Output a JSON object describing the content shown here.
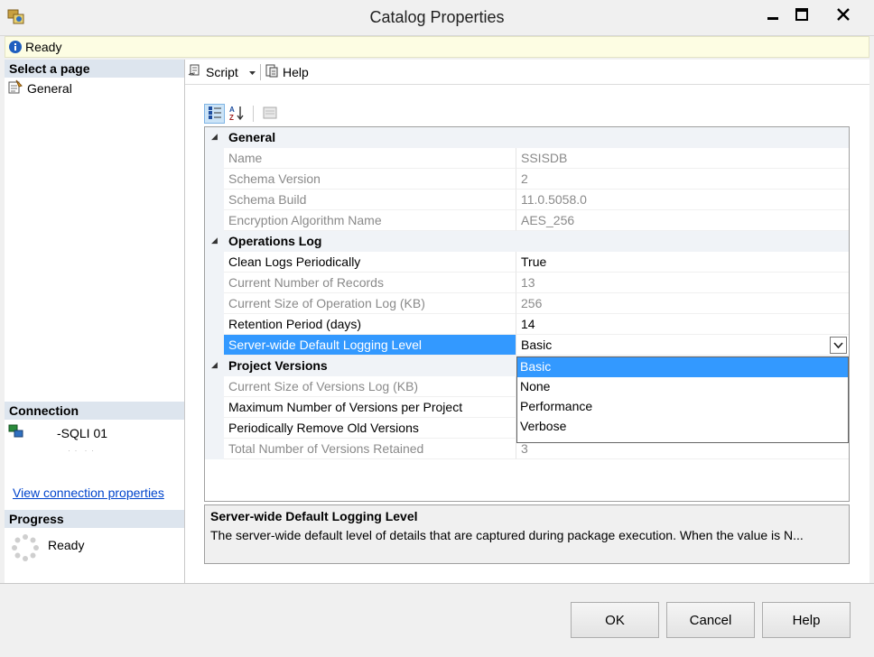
{
  "window": {
    "title": "Catalog Properties"
  },
  "status": {
    "text": "Ready"
  },
  "left_pane": {
    "select_page_header": "Select a page",
    "pages": [
      {
        "label": "General"
      }
    ],
    "connection_header": "Connection",
    "connection_server": "-SQLI 01",
    "connection_link": "View connection properties",
    "progress_header": "Progress",
    "progress_status": "Ready"
  },
  "toolbar": {
    "script_label": "Script",
    "help_label": "Help"
  },
  "grid": {
    "categories": [
      {
        "label": "General",
        "properties": [
          {
            "name": "Name",
            "value": "SSISDB",
            "readonly": true
          },
          {
            "name": "Schema Version",
            "value": "2",
            "readonly": true
          },
          {
            "name": "Schema Build",
            "value": "11.0.5058.0",
            "readonly": true
          },
          {
            "name": "Encryption Algorithm Name",
            "value": "AES_256",
            "readonly": true
          }
        ]
      },
      {
        "label": "Operations Log",
        "properties": [
          {
            "name": "Clean Logs Periodically",
            "value": "True",
            "readonly": false
          },
          {
            "name": "Current Number of Records",
            "value": "13",
            "readonly": true
          },
          {
            "name": "Current Size of Operation Log (KB)",
            "value": "256",
            "readonly": true
          },
          {
            "name": "Retention Period (days)",
            "value": "14",
            "readonly": false
          },
          {
            "name": "Server-wide Default Logging Level",
            "value": "Basic",
            "readonly": false
          }
        ]
      },
      {
        "label": "Project Versions",
        "properties": [
          {
            "name": "Current Size of Versions Log (KB)",
            "value": "",
            "readonly": true
          },
          {
            "name": "Maximum Number of Versions per Project",
            "value": "",
            "readonly": false
          },
          {
            "name": "Periodically Remove Old Versions",
            "value": "",
            "readonly": false
          },
          {
            "name": "Total Number of Versions Retained",
            "value": "3",
            "readonly": true
          }
        ]
      }
    ],
    "dropdown_options": [
      "Basic",
      "None",
      "Performance",
      "Verbose"
    ],
    "dropdown_selected": "Basic"
  },
  "description": {
    "title": "Server-wide Default Logging Level",
    "text": "The server-wide default level of details that are captured during package execution. When the value is N..."
  },
  "footer": {
    "ok_label": "OK",
    "cancel_label": "Cancel",
    "help_label": "Help"
  },
  "colors": {
    "selection": "#3399ff",
    "status_bar": "#fdfde3",
    "section_header": "#dde5ee",
    "link": "#0044cc"
  }
}
